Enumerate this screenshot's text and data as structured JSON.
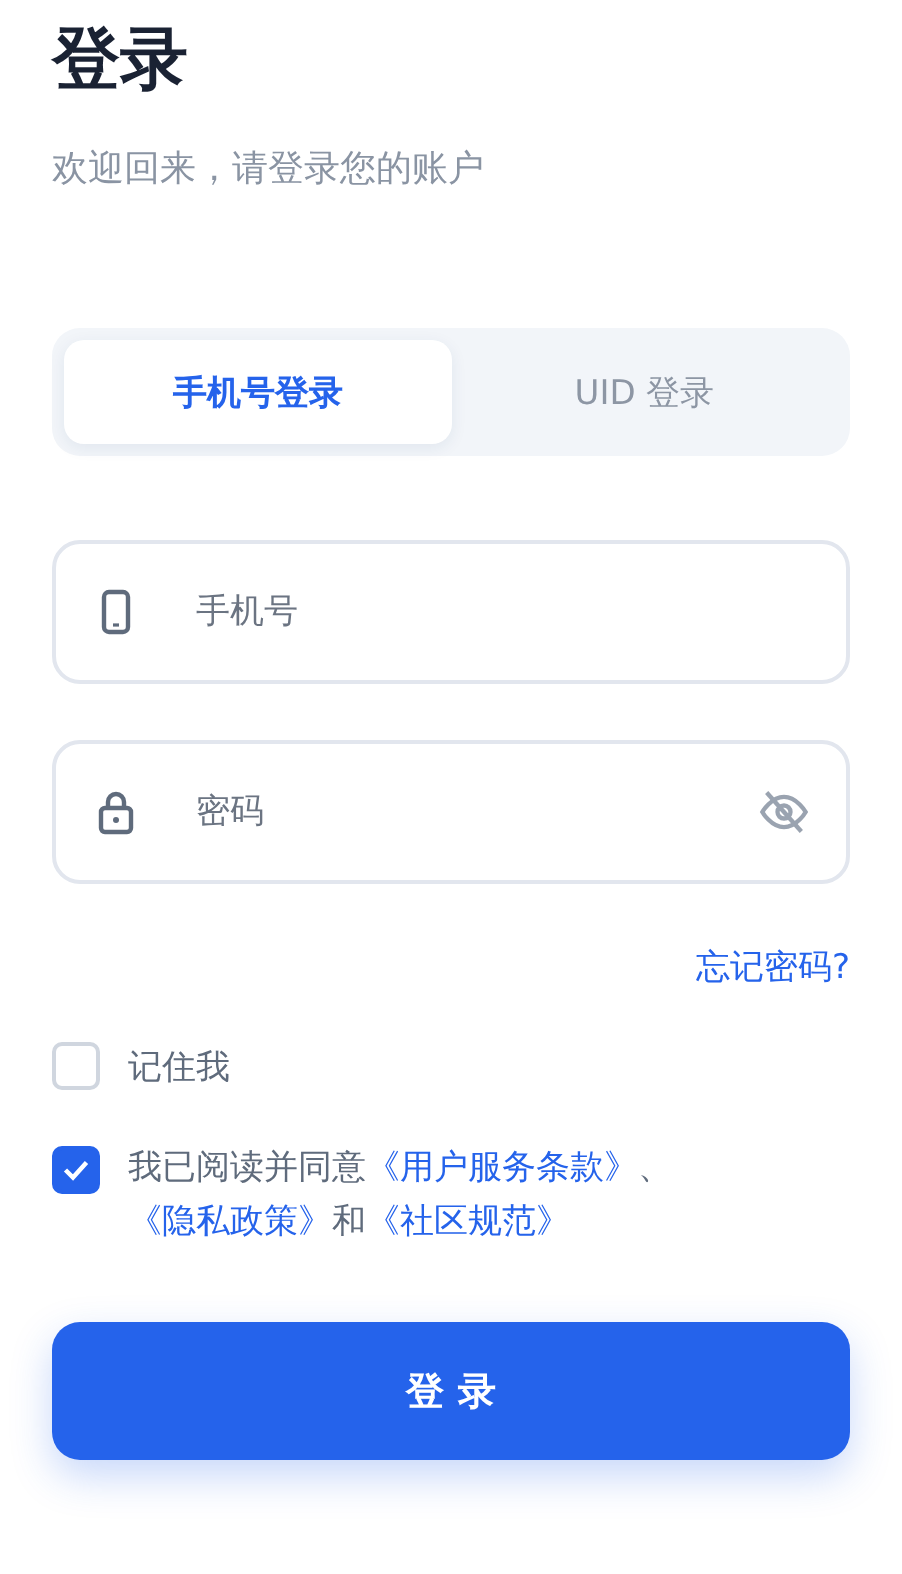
{
  "title": "登录",
  "subtitle": "欢迎回来，请登录您的账户",
  "tabs": [
    {
      "label": "手机号登录",
      "selected": true
    },
    {
      "label": "UID 登录",
      "selected": false
    }
  ],
  "fields": [
    {
      "kind": "phone",
      "placeholder": "手机号"
    },
    {
      "kind": "password",
      "placeholder": "密码",
      "reveal": false
    }
  ],
  "forgot_link": "忘记密码?",
  "remember": {
    "label": "记住我",
    "checked": false
  },
  "agreement": {
    "checked": true,
    "parts": [
      {
        "kind": "text",
        "text": "我已阅读并同意"
      },
      {
        "kind": "link",
        "text": "《用户服务条款》"
      },
      {
        "kind": "text",
        "text": "、"
      },
      {
        "kind": "link",
        "text": "《隐私政策》"
      },
      {
        "kind": "text",
        "text": "和"
      },
      {
        "kind": "link",
        "text": "《社区规范》"
      }
    ]
  },
  "submit": "登 录"
}
